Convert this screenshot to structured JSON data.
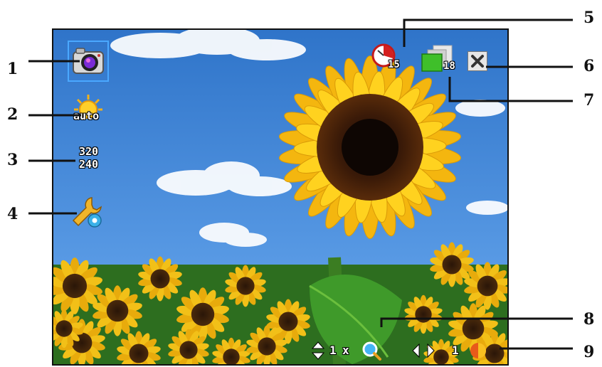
{
  "callouts": [
    "1",
    "2",
    "3",
    "4",
    "5",
    "6",
    "7",
    "8",
    "9"
  ],
  "hud": {
    "white_balance_label": "auto",
    "resolution_top": "320",
    "resolution_bottom": "240",
    "self_timer_value": "15",
    "remaining_shots": "18",
    "zoom_level": "1",
    "zoom_unit": "x",
    "brightness_level": "1"
  },
  "icons": {
    "capture_mode": "camera-icon",
    "white_balance": "sun-auto-icon",
    "resolution": "resolution-icon",
    "settings": "wrench-gear-icon",
    "self_timer": "self-timer-icon",
    "close": "close-icon",
    "storage": "storage-icon",
    "zoom": "zoom-icon",
    "brightness": "brightness-icon"
  },
  "colors": {
    "sky": "#3c83d6",
    "petal": "#f6c21a",
    "leaf": "#3f8f2a",
    "callout_line": "#111111"
  }
}
